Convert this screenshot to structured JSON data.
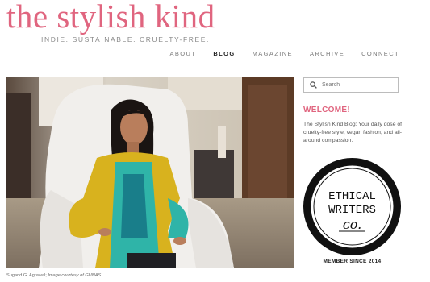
{
  "header": {
    "logo": "the stylish kind",
    "tagline": "INDIE. SUSTAINABLE. CRUELTY-FREE."
  },
  "nav": {
    "items": [
      {
        "label": "ABOUT"
      },
      {
        "label": "BLOG",
        "active": true
      },
      {
        "label": "MAGAZINE"
      },
      {
        "label": "ARCHIVE"
      },
      {
        "label": "CONNECT"
      }
    ]
  },
  "main": {
    "caption_name": "Sugand G. Agrawal; ",
    "caption_credit": "Image courtesy of GUNAS"
  },
  "sidebar": {
    "search_placeholder": "Search",
    "welcome_title": "WELCOME!",
    "welcome_text": "The Stylish Kind Blog: Your daily dose of cruelty-free style, vegan fashion, and all-around compassion.",
    "badge": {
      "line1": "ETHICAL",
      "line2": "WRITERS",
      "line3": "co."
    },
    "member_since": "MEMBER SINCE 2014"
  },
  "colors": {
    "accent": "#e0657f",
    "nav_text": "#7a7a7a",
    "dress_yellow": "#d8b21e",
    "dress_teal": "#2fb4a8"
  }
}
